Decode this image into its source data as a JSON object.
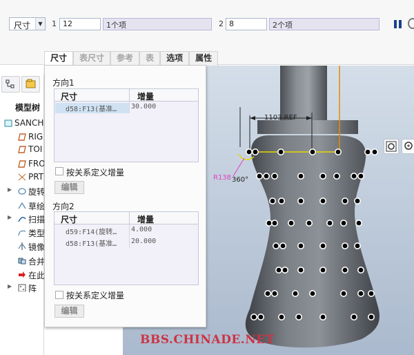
{
  "dashboard": {
    "type_select": "尺寸",
    "dir1_label": "1",
    "dir1_count": "12",
    "dir1_items": "1个项",
    "dir2_label": "2",
    "dir2_count": "8",
    "dir2_items": "2个项"
  },
  "tabs": [
    "尺寸",
    "表尺寸",
    "参考",
    "表",
    "选项",
    "属性"
  ],
  "popup": {
    "dir1_title": "方向1",
    "dir2_title": "方向2",
    "col_dim": "尺寸",
    "col_inc": "增量",
    "dir1_rows": [
      {
        "dim": "d58:F13(基准…",
        "inc": "30.000"
      }
    ],
    "dir2_rows": [
      {
        "dim": "d59:F14(旋转…",
        "inc": "4.000"
      },
      {
        "dim": "d58:F13(基准…",
        "inc": "20.000"
      }
    ],
    "relation_label": "按关系定义增量",
    "edit_label": "编辑"
  },
  "tree": {
    "title": "模型树",
    "nodes": [
      {
        "label": "SANCH",
        "icon": "part-icon"
      },
      {
        "label": "RIG",
        "icon": "datum-plane-icon"
      },
      {
        "label": "TOI",
        "icon": "datum-plane-icon"
      },
      {
        "label": "FRO",
        "icon": "datum-plane-icon"
      },
      {
        "label": "PRT",
        "icon": "coordinate-system-icon"
      },
      {
        "label": "旋转",
        "icon": "revolve-icon"
      },
      {
        "label": "草绘",
        "icon": "sketch-icon"
      },
      {
        "label": "扫描",
        "icon": "sweep-icon"
      },
      {
        "label": "类型",
        "icon": "type-icon"
      },
      {
        "label": "镜像",
        "icon": "mirror-icon"
      },
      {
        "label": "合并",
        "icon": "merge-icon"
      },
      {
        "label": "在此",
        "icon": "insert-here-icon"
      },
      {
        "label": "阵",
        "icon": "pattern-icon"
      }
    ]
  },
  "viewport": {
    "ref_dim": "1103 REF",
    "radius_dim": "R138",
    "angle_dim": "360°"
  },
  "watermark": "BBS.CHINADE.NET",
  "colors": {
    "accent_blue": "#1a3f8a",
    "model_gray": "#6d7176",
    "dim_yellow": "#e8d600",
    "dim_orange": "#e68a00",
    "watermark_red": "#cc3344",
    "radius_pink": "#e040c0"
  }
}
